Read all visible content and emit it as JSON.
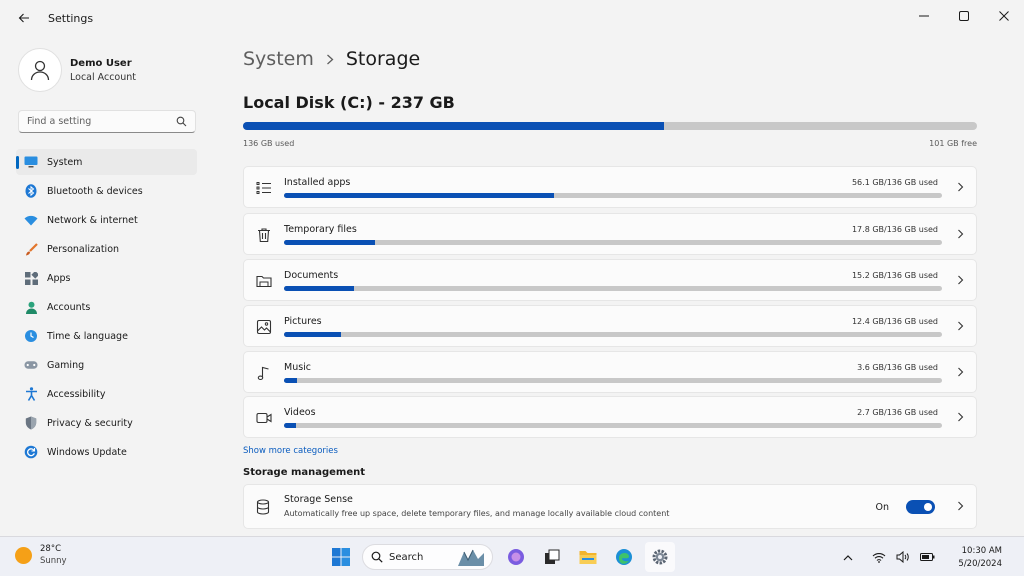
{
  "window": {
    "title": "Settings"
  },
  "profile": {
    "name": "Demo User",
    "account": "Local Account"
  },
  "search": {
    "placeholder": "Find a setting"
  },
  "nav": {
    "items": [
      {
        "label": "System",
        "icon": "monitor-icon",
        "active": true
      },
      {
        "label": "Bluetooth & devices",
        "icon": "bluetooth-icon"
      },
      {
        "label": "Network & internet",
        "icon": "wifi-icon"
      },
      {
        "label": "Personalization",
        "icon": "brush-icon"
      },
      {
        "label": "Apps",
        "icon": "apps-icon"
      },
      {
        "label": "Accounts",
        "icon": "person-icon"
      },
      {
        "label": "Time & language",
        "icon": "clock-globe-icon"
      },
      {
        "label": "Gaming",
        "icon": "gamepad-icon"
      },
      {
        "label": "Accessibility",
        "icon": "accessibility-icon"
      },
      {
        "label": "Privacy & security",
        "icon": "shield-icon"
      },
      {
        "label": "Windows Update",
        "icon": "update-icon"
      }
    ]
  },
  "breadcrumb": {
    "parent": "System",
    "current": "Storage"
  },
  "disk": {
    "title": "Local Disk (C:) - 237 GB",
    "used_label": "136 GB used",
    "free_label": "101 GB free",
    "used_fraction": 0.574
  },
  "categories": [
    {
      "label": "Installed apps",
      "size": "56.1 GB/136 GB used",
      "fraction": 0.41,
      "icon": "list-icon"
    },
    {
      "label": "Temporary files",
      "size": "17.8 GB/136 GB used",
      "fraction": 0.138,
      "icon": "trash-icon"
    },
    {
      "label": "Documents",
      "size": "15.2 GB/136 GB used",
      "fraction": 0.106,
      "icon": "folder-icon"
    },
    {
      "label": "Pictures",
      "size": "12.4 GB/136 GB used",
      "fraction": 0.086,
      "icon": "image-icon"
    },
    {
      "label": "Music",
      "size": "3.6 GB/136 GB used",
      "fraction": 0.02,
      "icon": "music-icon"
    },
    {
      "label": "Videos",
      "size": "2.7 GB/136 GB used",
      "fraction": 0.018,
      "icon": "video-icon"
    }
  ],
  "show_more": "Show more categories",
  "storage_management": {
    "title": "Storage management",
    "sense": {
      "title": "Storage Sense",
      "description": "Automatically free up space, delete temporary files, and manage locally available cloud content",
      "state": "On"
    }
  },
  "taskbar": {
    "weather": {
      "temp": "28°C",
      "condition": "Sunny"
    },
    "search_label": "Search",
    "time": "10:30 AM",
    "date": "5/20/2024"
  },
  "colors": {
    "accent": "#0a50b4",
    "track": "#c8c8c8",
    "background": "#f3f3f3",
    "card": "#fbfbfb"
  }
}
